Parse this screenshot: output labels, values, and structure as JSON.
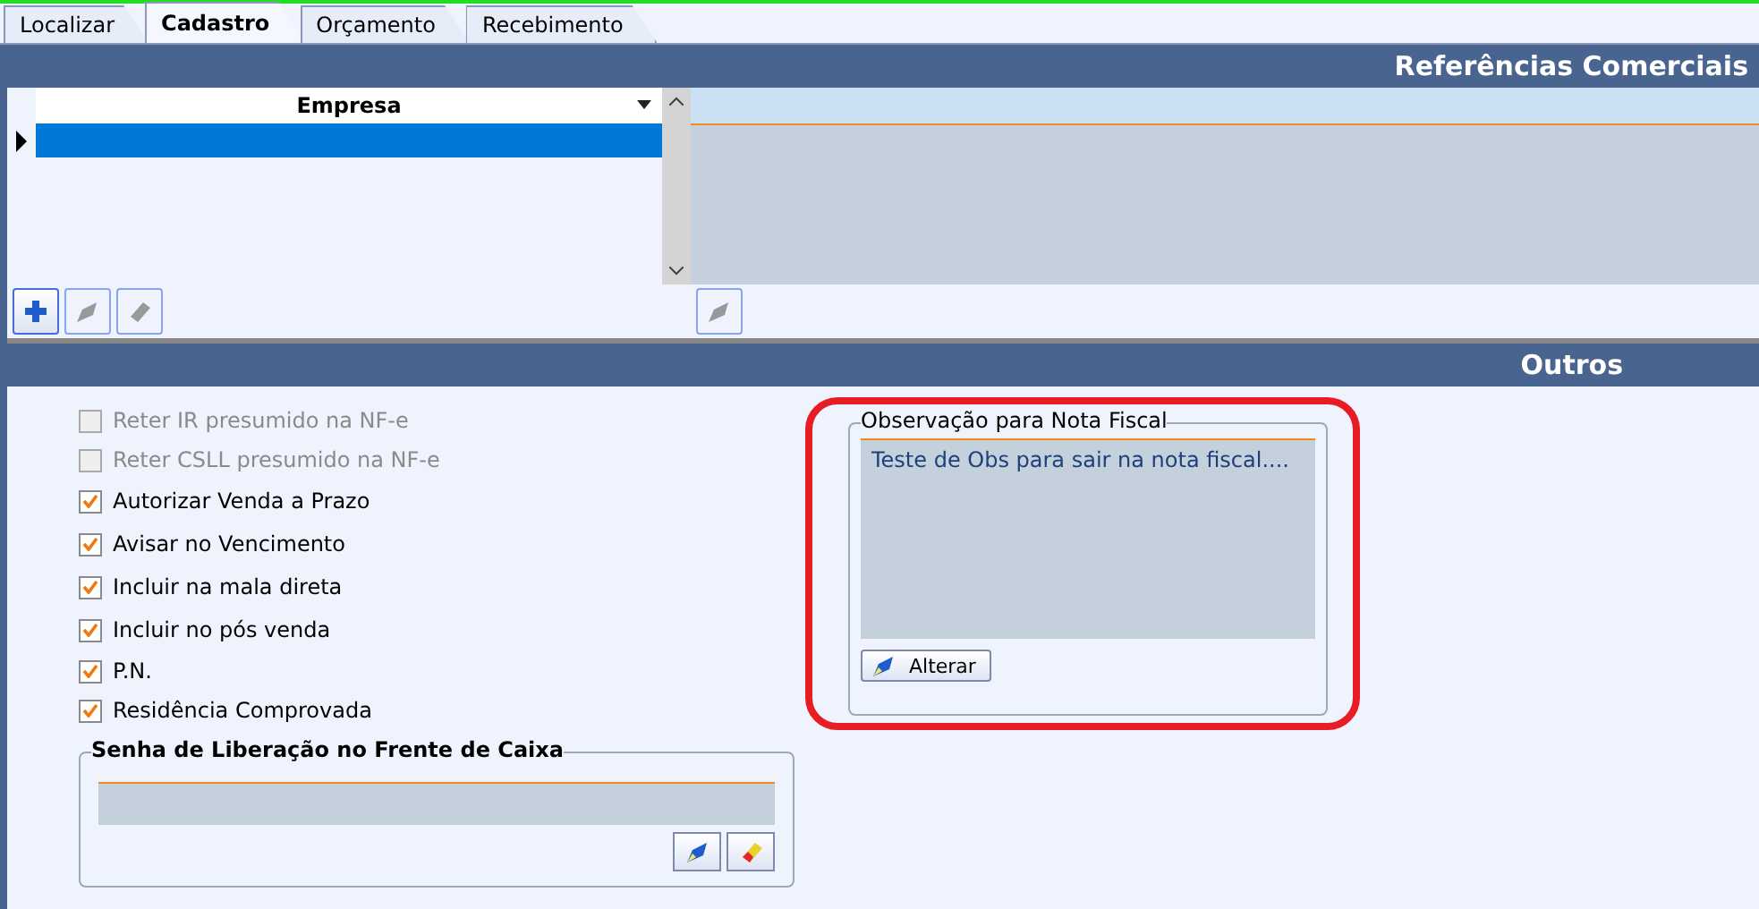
{
  "tabs": [
    {
      "label": "Localizar",
      "selected": false
    },
    {
      "label": "Cadastro",
      "selected": true
    },
    {
      "label": "Orçamento",
      "selected": false
    },
    {
      "label": "Recebimento",
      "selected": false
    }
  ],
  "referencias": {
    "title": "Referências Comerciais",
    "grid": {
      "column": "Empresa",
      "selected_row": true
    },
    "toolbar": [
      {
        "kind": "add",
        "disabled": false
      },
      {
        "kind": "edit",
        "disabled": true
      },
      {
        "kind": "erase",
        "disabled": true
      }
    ],
    "detail_toolbar": [
      {
        "kind": "edit",
        "disabled": true
      }
    ]
  },
  "outros": {
    "title": "Outros",
    "options": [
      {
        "label": "Reter IR presumido na NF-e",
        "checked": false,
        "disabled": true
      },
      {
        "label": "Reter CSLL presumido na NF-e",
        "checked": false,
        "disabled": true
      },
      {
        "label": "Autorizar Venda a Prazo",
        "checked": true,
        "disabled": false
      },
      {
        "label": "Avisar no Vencimento",
        "checked": true,
        "disabled": false
      },
      {
        "label": "Incluir na mala direta",
        "checked": true,
        "disabled": false
      },
      {
        "label": "Incluir no pós venda",
        "checked": true,
        "disabled": false
      },
      {
        "label": "P.N.",
        "checked": true,
        "disabled": false
      },
      {
        "label": "Residência Comprovada",
        "checked": true,
        "disabled": false
      }
    ],
    "senha": {
      "title": "Senha de Liberação no Frente de Caixa",
      "buttons": [
        {
          "kind": "edit"
        },
        {
          "kind": "erase"
        }
      ]
    },
    "observacao": {
      "title": "Observação para Nota Fiscal",
      "text": "Teste de Obs para sair na nota fiscal....",
      "button": "Alterar",
      "highlighted": true
    }
  }
}
